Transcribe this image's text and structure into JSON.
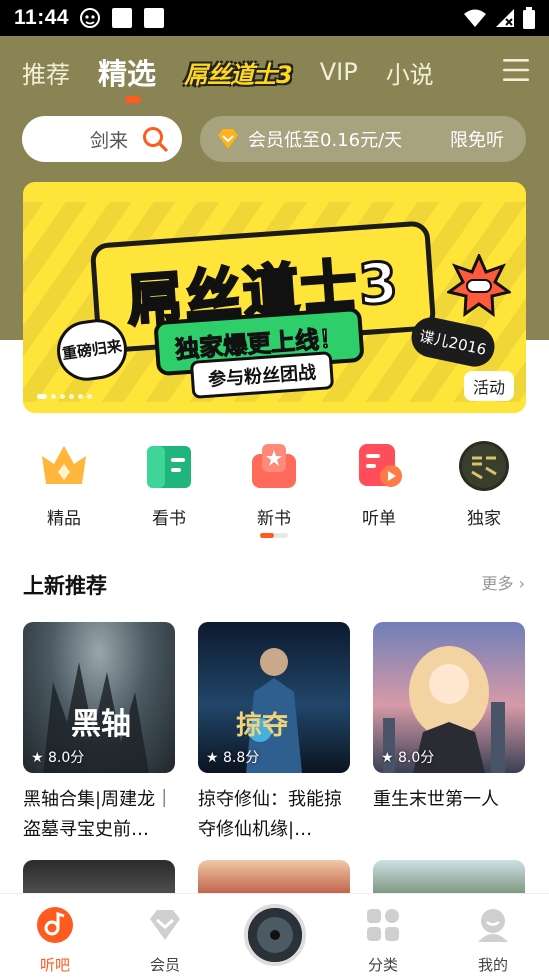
{
  "status_bar": {
    "time": "11:44"
  },
  "top_nav": {
    "tabs": [
      "推荐",
      "精选",
      "屌丝道士3",
      "VIP",
      "小说"
    ],
    "active_index": 1
  },
  "search": {
    "placeholder": "剑来"
  },
  "vip_promo": {
    "text": "会员低至0.16元/天",
    "action": "限免听"
  },
  "banner": {
    "title": "屌丝道士3",
    "subtitle": "独家爆更上线！",
    "tagline": "参与粉丝团战",
    "badge": "重磅归来",
    "author_sign": "谍儿2016",
    "tag": "活动",
    "page_count": 6,
    "active_page": 0
  },
  "categories": [
    {
      "label": "精品",
      "icon": "crown-icon"
    },
    {
      "label": "看书",
      "icon": "book-icon"
    },
    {
      "label": "新书",
      "icon": "new-book-icon"
    },
    {
      "label": "听单",
      "icon": "playlist-icon"
    },
    {
      "label": "独家",
      "icon": "exclusive-icon"
    }
  ],
  "section": {
    "title": "上新推荐",
    "more": "更多"
  },
  "books": [
    {
      "title": "黑轴合集|周建龙｜盗墓寻宝史前…",
      "rating": "8.0分",
      "cover_color": "#34424f"
    },
    {
      "title": "掠夺修仙：我能掠夺修仙机缘|…",
      "rating": "8.8分",
      "cover_color": "#1f3550"
    },
    {
      "title": "重生末世第一人",
      "rating": "8.0分",
      "cover_color": "#4a5a86"
    }
  ],
  "bottom_nav": {
    "items": [
      "听吧",
      "会员",
      "分类",
      "我的"
    ],
    "active_index": 0
  },
  "colors": {
    "accent": "#ff5a1f",
    "hero_bg": "#8a8455"
  }
}
